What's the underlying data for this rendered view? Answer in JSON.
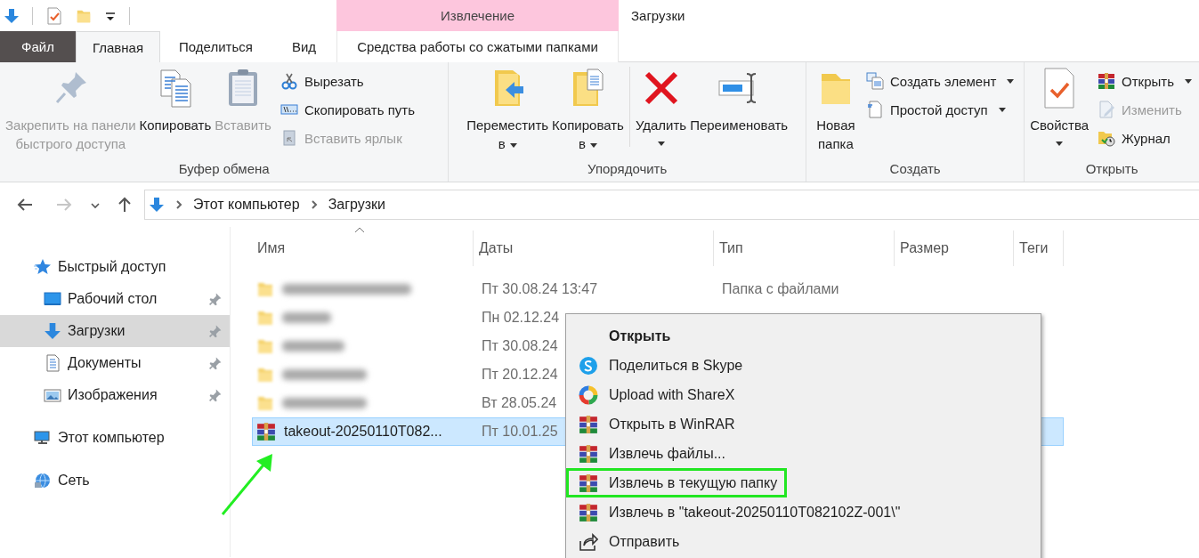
{
  "window": {
    "title": "Загрузки"
  },
  "tabs": [
    {
      "kind": "file",
      "label": "Файл",
      "selected": false
    },
    {
      "kind": "tab",
      "label": "Главная",
      "selected": true
    },
    {
      "kind": "tab",
      "label": "Поделиться",
      "selected": false
    },
    {
      "kind": "tab",
      "label": "Вид",
      "selected": false
    },
    {
      "kind": "context",
      "group": "Извлечение",
      "label": "Средства работы со сжатыми папками",
      "selected": false
    }
  ],
  "ribbon": {
    "groups": [
      {
        "label": "Буфер обмена",
        "items": [
          {
            "kind": "large",
            "lines": [
              "Закрепить на панели",
              "быстрого доступа"
            ],
            "disabled": true,
            "dropdown": false
          },
          {
            "kind": "large",
            "lines": [
              "Копировать"
            ],
            "disabled": false,
            "dropdown": false
          },
          {
            "kind": "large",
            "lines": [
              "Вставить"
            ],
            "disabled": true,
            "dropdown": false
          },
          {
            "kind": "stack",
            "items": [
              {
                "label": "Вырезать",
                "disabled": false,
                "dropdown": false
              },
              {
                "label": "Скопировать путь",
                "disabled": false,
                "dropdown": false
              },
              {
                "label": "Вставить ярлык",
                "disabled": true,
                "dropdown": false
              }
            ]
          }
        ]
      },
      {
        "label": "Упорядочить",
        "items": [
          {
            "kind": "large",
            "lines": [
              "Переместить",
              "в"
            ],
            "disabled": false,
            "dropdown": true
          },
          {
            "kind": "large",
            "lines": [
              "Копировать",
              "в"
            ],
            "disabled": false,
            "dropdown": true
          },
          {
            "kind": "separator"
          },
          {
            "kind": "large",
            "lines": [
              "Удалить"
            ],
            "disabled": false,
            "dropdown": true
          },
          {
            "kind": "large",
            "lines": [
              "Переименовать"
            ],
            "disabled": false,
            "dropdown": false
          }
        ]
      },
      {
        "label": "Создать",
        "items": [
          {
            "kind": "large",
            "lines": [
              "Новая",
              "папка"
            ],
            "disabled": false,
            "dropdown": false
          },
          {
            "kind": "stack",
            "items": [
              {
                "label": "Создать элемент",
                "disabled": false,
                "dropdown": true
              },
              {
                "label": "Простой доступ",
                "disabled": false,
                "dropdown": true
              }
            ]
          }
        ]
      },
      {
        "label": "Открыть",
        "items": [
          {
            "kind": "large",
            "lines": [
              "Свойства"
            ],
            "disabled": false,
            "dropdown": true
          },
          {
            "kind": "stack",
            "items": [
              {
                "label": "Открыть",
                "disabled": false,
                "dropdown": true
              },
              {
                "label": "Изменить",
                "disabled": true,
                "dropdown": false
              },
              {
                "label": "Журнал",
                "disabled": false,
                "dropdown": false
              }
            ]
          }
        ]
      }
    ]
  },
  "address": {
    "path": [
      "Этот компьютер",
      "Загрузки"
    ]
  },
  "sidebar": {
    "items": [
      {
        "label": "Быстрый доступ",
        "selected": false,
        "children": [
          {
            "label": "Рабочий стол",
            "pinned": true,
            "selected": false
          },
          {
            "label": "Загрузки",
            "pinned": true,
            "selected": true
          },
          {
            "label": "Документы",
            "pinned": true,
            "selected": false
          },
          {
            "label": "Изображения",
            "pinned": true,
            "selected": false
          }
        ]
      },
      {
        "label": "Этот компьютер",
        "selected": false
      },
      {
        "label": "Сеть",
        "selected": false
      }
    ]
  },
  "table": {
    "columns": [
      {
        "label": "Имя",
        "sorted": true
      },
      {
        "label": "Даты",
        "sorted": false
      },
      {
        "label": "Тип",
        "sorted": false
      },
      {
        "label": "Размер",
        "sorted": false
      },
      {
        "label": "Теги",
        "sorted": false
      }
    ],
    "rows": [
      {
        "kind": "folder",
        "name_hidden": true,
        "date": "Пт 30.08.24 13:47",
        "type": "Папка с файлами",
        "selected": false,
        "pointed_at": false
      },
      {
        "kind": "folder",
        "name_hidden": true,
        "date": "Пн 02.12.24",
        "selected": false,
        "pointed_at": false
      },
      {
        "kind": "folder",
        "name_hidden": true,
        "date": "Пт 30.08.24",
        "selected": false,
        "pointed_at": false
      },
      {
        "kind": "folder",
        "name_hidden": true,
        "date": "Пт 20.12.24",
        "selected": false,
        "pointed_at": false
      },
      {
        "kind": "folder",
        "name_hidden": true,
        "date": "Вт 28.05.24",
        "selected": false,
        "pointed_at": false
      },
      {
        "kind": "archive",
        "name": "takeout-20250110T082...",
        "date": "Пт 10.01.25",
        "selected": true,
        "pointed_at": true
      }
    ]
  },
  "context_menu": {
    "items": [
      {
        "kind": "default",
        "label": "Открыть",
        "annotated": false
      },
      {
        "kind": "command",
        "label": "Поделиться в Skype",
        "annotated": false
      },
      {
        "kind": "command",
        "label": "Upload with ShareX",
        "annotated": false
      },
      {
        "kind": "command",
        "label": "Открыть в WinRAR",
        "annotated": false
      },
      {
        "kind": "command",
        "label": "Извлечь файлы...",
        "annotated": false
      },
      {
        "kind": "command",
        "label": "Извлечь в текущую папку",
        "annotated": true
      },
      {
        "kind": "command",
        "label": "Извлечь в \"takeout-20250110T082102Z-001\\\"",
        "annotated": false
      },
      {
        "kind": "command",
        "label": "Отправить",
        "annotated": false
      }
    ]
  }
}
